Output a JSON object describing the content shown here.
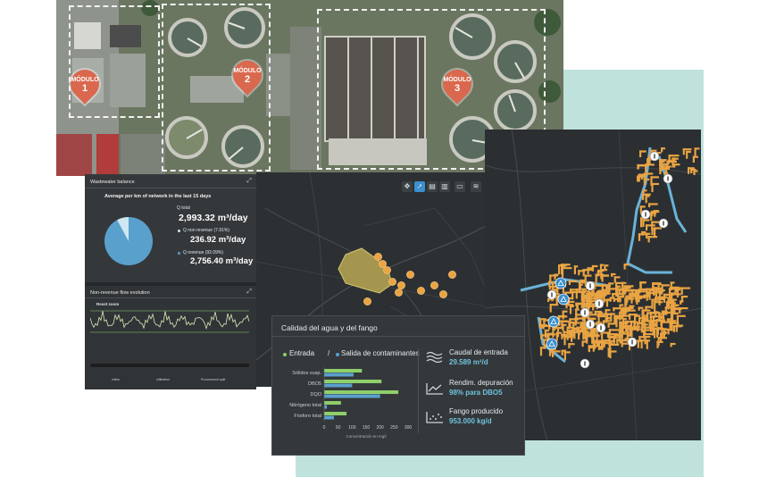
{
  "aerial": {
    "modules": [
      {
        "label": "MÓDULO",
        "num": "1"
      },
      {
        "label": "MÓDULO",
        "num": "2"
      },
      {
        "label": "MÓDULO",
        "num": "3"
      }
    ]
  },
  "wastewater": {
    "title": "Wastewater balance",
    "subtitle": "Average per km of network in the last 15 days",
    "q_total_label": "Q total",
    "q_total_value": "2,993.32 m³/day",
    "q_nonrev_label": "Q non revenue (7.91%)",
    "q_nonrev_value": "236.92 m³/day",
    "q_rev_label": "Q revenue (92.09%)",
    "q_rev_value": "2,756.40 m³/day",
    "pie": {
      "nonrev_fraction": 0.0791,
      "color_rev": "#5aa0cc",
      "color_nonrev": "#cfe6f3"
    }
  },
  "nrflow": {
    "title": "Non-revenue flow evolution",
    "reset": "Reset zoom",
    "legend": [
      "inflow",
      "infiltration",
      "Procurement split"
    ]
  },
  "quality": {
    "title": "Calidad del agua y del fango",
    "legend_in": "Entrada",
    "legend_sep": "/",
    "legend_out": "Salida de contaminantes",
    "xlabel": "Concentración en mg/l",
    "stats": [
      {
        "label": "Caudal de entrada",
        "value": "29.589 m³/d",
        "icon": "waves-icon"
      },
      {
        "label": "Rendim. depuración",
        "value": "98% para DBO5",
        "icon": "trend-chart-icon"
      },
      {
        "label": "Fango producido",
        "value": "953.000 kg/d",
        "icon": "scatter-dots-icon"
      }
    ]
  },
  "chart_data": {
    "type": "bar",
    "orientation": "horizontal",
    "categories": [
      "Sólidos susp.",
      "DBO5",
      "DQO",
      "Nitrógeno total",
      "Fósforo total"
    ],
    "series": [
      {
        "name": "Entrada",
        "color": "#8fcf6a",
        "values": [
          135,
          205,
          265,
          60,
          80
        ]
      },
      {
        "name": "Salida de contaminantes",
        "color": "#5aa0cc",
        "values": [
          105,
          100,
          200,
          10,
          35
        ]
      }
    ],
    "xticks": [
      "0",
      "50",
      "100",
      "150",
      "200",
      "250",
      "300"
    ],
    "xlabel": "Concentración en mg/l",
    "xlim": [
      0,
      300
    ]
  },
  "colors": {
    "accent": "#e9a443",
    "panel": "#34383b",
    "blue": "#5aa0cc",
    "green": "#8fcf6a"
  }
}
